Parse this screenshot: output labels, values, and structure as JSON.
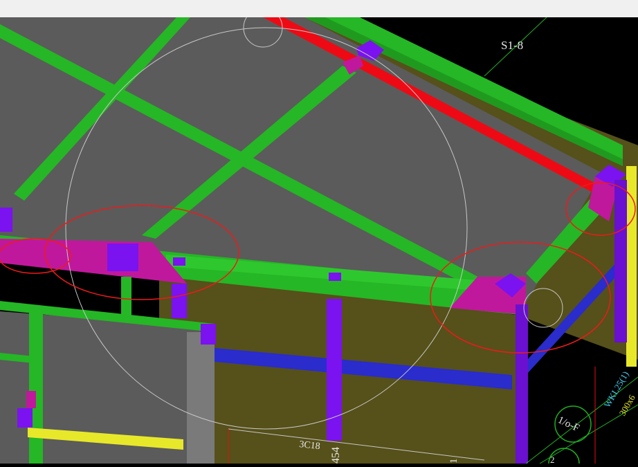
{
  "window": {
    "title": ""
  },
  "viewport": {
    "background": "#000000",
    "labels": {
      "axis_label": "S1-8",
      "rebar_label": "3C18",
      "vertical_dim": "454",
      "grid_bubble": "1/o-F",
      "beam_tag": "WKL25(1)",
      "beam_size": "300x6",
      "partial_tag": "1",
      "bottom_bubble": "2"
    }
  },
  "colors": {
    "slab": "#5b5b5b",
    "beam": "#25b725",
    "beam_dark": "#1f9a1f",
    "column": "#7b12f0",
    "joint": "#c0189c",
    "wall_face": "#56501a",
    "wall_band": "#2a2ccc",
    "red_beam": "#ee0a14",
    "yellow": "#e8e82a",
    "markup": "#ee1a1a",
    "cad_line": "#20b020",
    "cad_text": "#e8e8e8",
    "cyan_text": "#40d0f0"
  }
}
